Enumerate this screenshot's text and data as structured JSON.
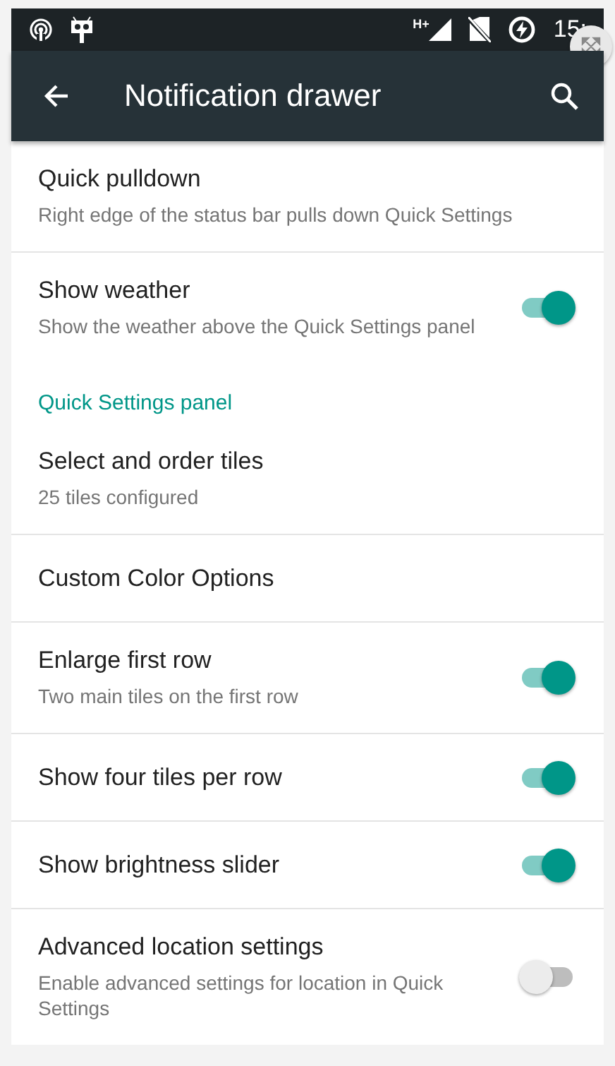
{
  "status_bar": {
    "network_type": "H+",
    "time": "15:"
  },
  "toolbar": {
    "title": "Notification drawer"
  },
  "items": [
    {
      "kind": "setting",
      "title": "Quick pulldown",
      "summary": "Right edge of the status bar pulls down Quick Settings",
      "divider": true
    },
    {
      "kind": "toggle",
      "title": "Show weather",
      "summary": "Show the weather above the Quick Settings panel",
      "on": true,
      "divider": false
    },
    {
      "kind": "header",
      "title": "Quick Settings panel"
    },
    {
      "kind": "setting",
      "title": "Select and order tiles",
      "summary": "25 tiles configured",
      "divider": true
    },
    {
      "kind": "setting",
      "title": "Custom Color Options",
      "divider": true
    },
    {
      "kind": "toggle",
      "title": "Enlarge first row",
      "summary": "Two main tiles on the first row",
      "on": true,
      "divider": true
    },
    {
      "kind": "toggle",
      "title": "Show four tiles per row",
      "on": true,
      "divider": true
    },
    {
      "kind": "toggle",
      "title": "Show brightness slider",
      "on": true,
      "divider": true
    },
    {
      "kind": "toggle",
      "title": "Advanced location settings",
      "summary": "Enable advanced settings for location in Quick Settings",
      "on": false,
      "divider": false
    }
  ]
}
